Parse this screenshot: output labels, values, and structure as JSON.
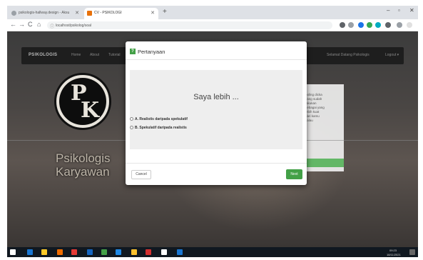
{
  "browser": {
    "tabs": [
      {
        "label": "psikologis-hallway.design - Aksu",
        "active": false
      },
      {
        "label": "CV - PSIKOLOGI",
        "active": true
      }
    ],
    "new_tab": "+",
    "window_controls": {
      "minimize": "–",
      "maximize": "▫",
      "close": "✕"
    },
    "nav": {
      "back": "←",
      "forward": "→",
      "reload": "C",
      "home": "⌂"
    },
    "address": "localhost/psikolog/soal",
    "ext_colors": [
      "#5f6368",
      "#9aa0a6",
      "#1a73e8",
      "#34a853",
      "#00acc1",
      "#5f6368",
      "#9aa0a6",
      "#e0e0e0"
    ]
  },
  "site": {
    "brand": "PSIKOLOGIS",
    "nav_links": [
      "Home",
      "About",
      "Tutorial"
    ],
    "nav_right": [
      "Selamat Datang Psikologis",
      "Logout ▾"
    ],
    "logo": {
      "p": "P",
      "k": "K"
    },
    "title_line1": "Psikologis",
    "title_line2": "Karyawan",
    "side_text": [
      "poling dicka",
      "yang sudah",
      "lakukan",
      "sebagai yang",
      "lebih kuat",
      "dari kamu",
      "kalau"
    ]
  },
  "modal": {
    "icon": "?",
    "title": "Pertanyaan",
    "question": "Saya lebih ...",
    "options": [
      {
        "label": "A. Realistis daripada spekulatif"
      },
      {
        "label": "B. Spekulatif daripada realistis"
      }
    ],
    "cancel_label": "Cancel",
    "next_label": "Next",
    "accent": "#43a047"
  },
  "taskbar": {
    "clock_time": "09:23",
    "clock_date": "18/11/2021",
    "icon_colors": [
      "#ffffff",
      "#1976d2",
      "#ffca28",
      "#ef6c00",
      "#e53935",
      "#1565c0",
      "#43a047",
      "#1e88e5",
      "#fbc02d",
      "#d32f2f"
    ]
  }
}
